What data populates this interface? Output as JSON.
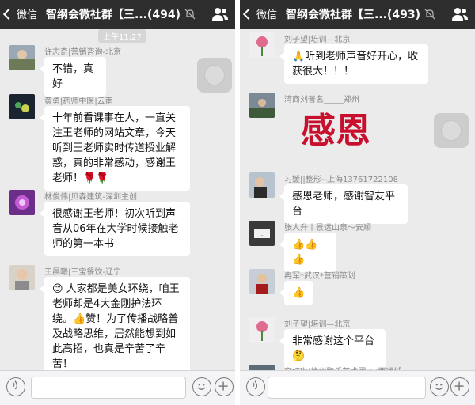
{
  "left": {
    "nav": {
      "back_label": "微信",
      "title": "智纲会微社群【三...(494)"
    },
    "time_chip": "上午11:27",
    "messages": [
      {
        "sender": "许志奇|营销咨询-北京",
        "text": "不错，真好"
      },
      {
        "sender": "黄勇|药师中医|云南",
        "text": "十年前看课事在人，一直关注王老师的网站文章，今天听到王老师实时传道授业解惑，真的非常感动，感谢王老师！🌹🌹"
      },
      {
        "sender": "林俊伟|贝森建筑-深圳主创",
        "text": "很感谢王老师！初次听到声音从06年在大学时候接触老师的第一本书"
      },
      {
        "sender": "王晨曦|三宝餐饮-辽宁",
        "text": "😊 人家都是美女环绕，咱王老师却是4大金刚护法环绕。👍赞！为了传播战略普及战略思维，居然能想到如此高招，也真是辛苦了辛苦！"
      }
    ]
  },
  "right": {
    "nav": {
      "back_label": "微信",
      "title": "智纲会微社群【三...(493)"
    },
    "messages": [
      {
        "sender": "刘子望|培训—北京",
        "text": "🙏听到老师声音好开心，收获很大！！！"
      },
      {
        "sender": "湾商刘普名_____郑州",
        "sticker_text": "感恩"
      },
      {
        "sender": "习媛||整形--上海13761722108",
        "text": "感恩老师，感谢智友平台"
      },
      {
        "sender": "张人升丨景运山泉～安顺",
        "text": "👍👍👍"
      },
      {
        "sender": "冉军*武汉*营销策划",
        "text": "👍"
      },
      {
        "sender": "刘子望|培训—北京",
        "text": "非常感谢这个平台🤔"
      },
      {
        "sender": "高红琳|徐州鹏乐艺术团_山西运城"
      }
    ]
  },
  "icons": {
    "back": "chevron-left-icon",
    "mute": "mute-bell-icon",
    "group": "group-people-icon",
    "voice": "voice-icon",
    "emoji": "emoji-icon",
    "plus": "plus-icon"
  },
  "colors": {
    "nav_bg": "#2e2e2e",
    "chat_bg": "#ebebeb",
    "bubble_bg": "#ffffff",
    "sender_text": "#8a8a8a",
    "sticker_red": "#c8102e"
  }
}
